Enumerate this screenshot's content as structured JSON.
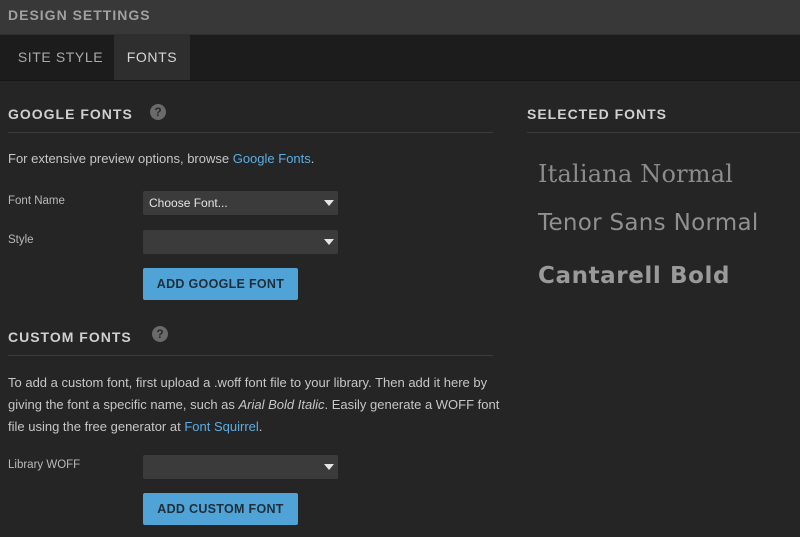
{
  "window": {
    "title": "DESIGN SETTINGS"
  },
  "tabs": [
    {
      "label": "SITE STYLE"
    },
    {
      "label": "FONTS"
    }
  ],
  "google_fonts": {
    "heading": "GOOGLE FONTS",
    "help": "?",
    "intro": "For extensive preview options, browse ",
    "intro_link": "Google Fonts",
    "intro_end": ".",
    "font_name_label": "Font Name",
    "font_name_value": "Choose Font...",
    "style_label": "Style",
    "style_value": "",
    "add_button": "ADD GOOGLE FONT"
  },
  "custom_fonts": {
    "heading": "CUSTOM FONTS",
    "help": "?",
    "text_1": "To add a custom font, first upload a .woff font file to your library. Then add it here by giving the font a specific name, such as ",
    "text_italic": "Arial Bold Italic",
    "text_2": ". Easily generate a WOFF font file using the free generator at ",
    "text_link": "Font Squirrel",
    "text_end": ".",
    "library_label": "Library WOFF",
    "library_value": "",
    "add_button": "ADD CUSTOM FONT"
  },
  "selected_fonts": {
    "heading": "SELECTED FONTS",
    "items": [
      "Italiana Normal",
      "Tenor Sans Normal",
      "Cantarell Bold"
    ]
  }
}
